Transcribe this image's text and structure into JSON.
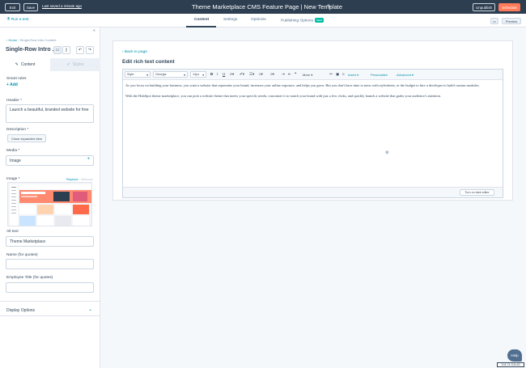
{
  "topbar": {
    "exit": "Exit",
    "save": "Save",
    "last_saved": "Last saved a minute ago",
    "title": "Theme Marketplace CMS Feature Page | New Template",
    "unpublish": "Unpublish",
    "schedule": "Schedule"
  },
  "tabbar": {
    "run_test": "Run a test",
    "tabs": [
      "Content",
      "Settings",
      "Optimize",
      "Publishing Options"
    ],
    "new_badge": "NEW",
    "preview": "Preview"
  },
  "sidebar": {
    "breadcrumb_home": "Home",
    "breadcrumb_current": "Single-Row Intro Content",
    "module_title": "Single-Row Intro ...",
    "tab_content": "Content",
    "tab_styles": "Styles",
    "smart_rules": "Smart rules",
    "add": "Add",
    "header_label": "Header *",
    "header_value": "Launch a beautiful, branded website for free",
    "description_label": "Description *",
    "close_expanded": "Close expanded view",
    "media_label": "Media *",
    "media_value": "Image",
    "image_label": "Image *",
    "replace": "Replace",
    "remove": "Remove",
    "alt_text_label": "Alt text",
    "alt_text_value": "Theme Marketplace",
    "name_quotes_label": "Name (for quotes)",
    "name_quotes_value": "",
    "employee_title_label": "Employee Title (for quotes)",
    "employee_title_value": "",
    "display_options": "Display Options"
  },
  "editor": {
    "back": "Back to page",
    "title": "Edit rich text content",
    "toolbar": {
      "style": "Style",
      "font": "Georgia",
      "size": "14px",
      "more": "More",
      "insert": "Insert",
      "personalize": "Personalize",
      "advanced": "Advanced"
    },
    "paragraphs": [
      "As you focus on building your business, you want a website that represents your brand, increases your online exposure, and helps you grow. But you don't have time to mess with stylesheets, or the budget to hire a developer to build custom modules.",
      "With the HubSpot theme marketplace, you can pick a website theme that meets your specific needs, customize it to match your brand with just a few clicks, and quickly launch a website that grabs your audience's attention."
    ],
    "dark_editor": "Turn on dark editor"
  },
  "help": "Help",
  "resolution": "104.74  104.63"
}
